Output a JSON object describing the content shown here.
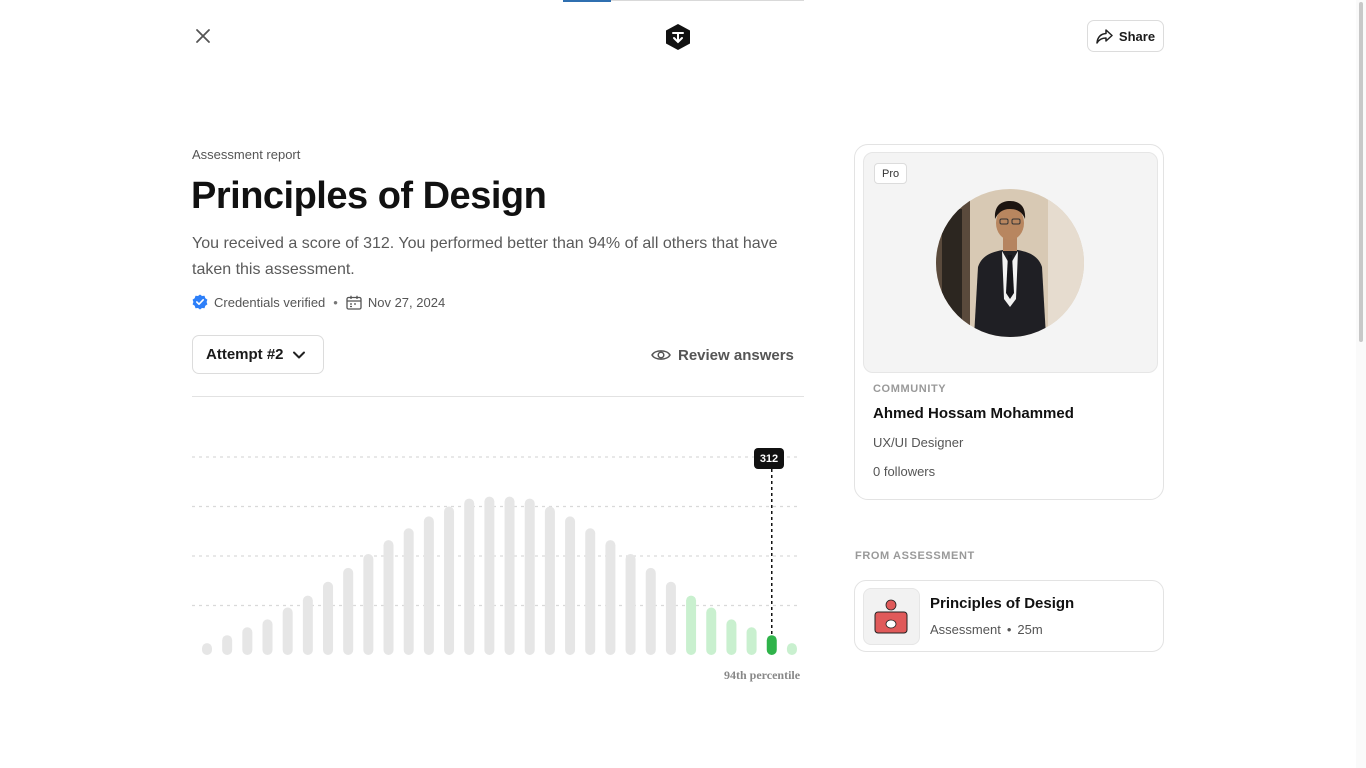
{
  "header": {
    "close_icon": "close-icon",
    "logo_icon": "cube-logo-icon",
    "share_label": "Share",
    "progress_fraction": 0.2
  },
  "report": {
    "eyebrow": "Assessment report",
    "title": "Principles of Design",
    "summary": "You received a score of 312. You performed better than 94% of all others that have taken this assessment.",
    "credentials": "Credentials verified",
    "separator": "•",
    "date": "Nov 27, 2024",
    "attempt_label": "Attempt #2",
    "review_label": "Review answers"
  },
  "chart_data": {
    "type": "bar",
    "values": [
      6,
      10,
      14,
      18,
      24,
      30,
      37,
      44,
      51,
      58,
      64,
      70,
      75,
      79,
      80,
      80,
      79,
      75,
      70,
      64,
      58,
      51,
      44,
      37,
      30,
      24,
      18,
      14,
      10,
      6
    ],
    "highlight_start": 24,
    "current_index": 28,
    "score_label": "312",
    "percentile_label": "94th percentile",
    "ylim": [
      0,
      100
    ],
    "grid": true,
    "colors": {
      "base": "#e6e6e6",
      "above": "#c9f0cf",
      "current": "#2fb34a"
    }
  },
  "profile": {
    "badge": "Pro",
    "eyebrow": "COMMUNITY",
    "name": "Ahmed Hossam Mohammed",
    "role": "UX/UI Designer",
    "followers": "0 followers"
  },
  "from_assessment": {
    "label": "FROM ASSESSMENT",
    "title": "Principles of Design",
    "type": "Assessment",
    "separator": "•",
    "duration": "25m"
  }
}
